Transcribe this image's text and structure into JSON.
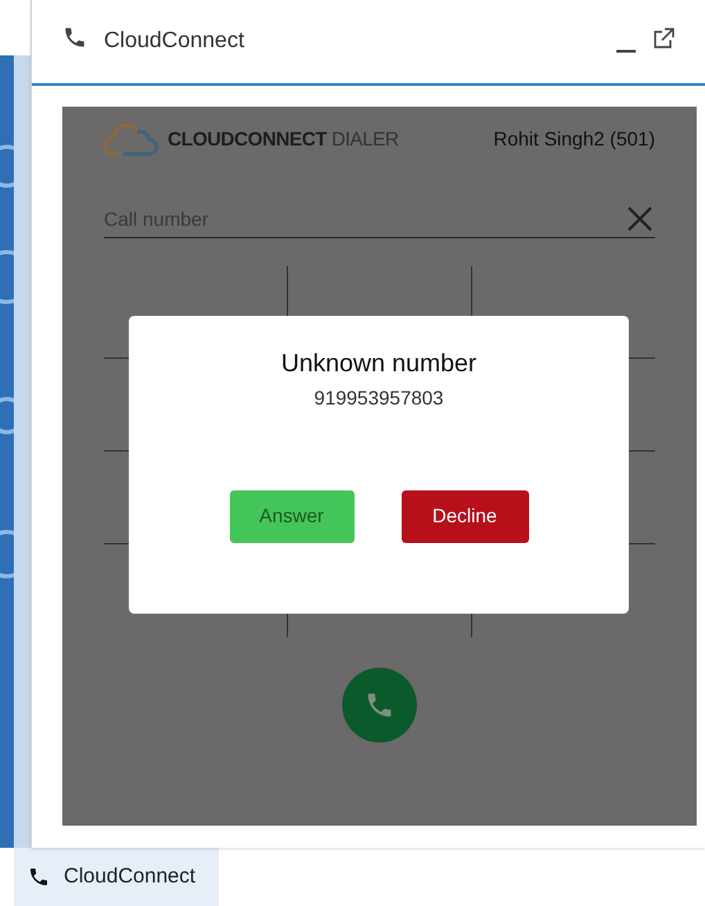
{
  "window": {
    "title": "CloudConnect"
  },
  "dialer": {
    "brand": "CLOUDCONNECT",
    "brand_suffix": "DIALER",
    "user": "Rohit Singh2 (501)",
    "call_field": {
      "placeholder": "Call number"
    }
  },
  "incoming_call": {
    "title": "Unknown number",
    "number": "919953957803",
    "buttons": [
      {
        "label": "Answer",
        "kind": "answer"
      },
      {
        "label": "Decline",
        "kind": "decline"
      }
    ]
  },
  "taskbar": {
    "items": [
      {
        "label": "CloudConnect"
      }
    ]
  }
}
